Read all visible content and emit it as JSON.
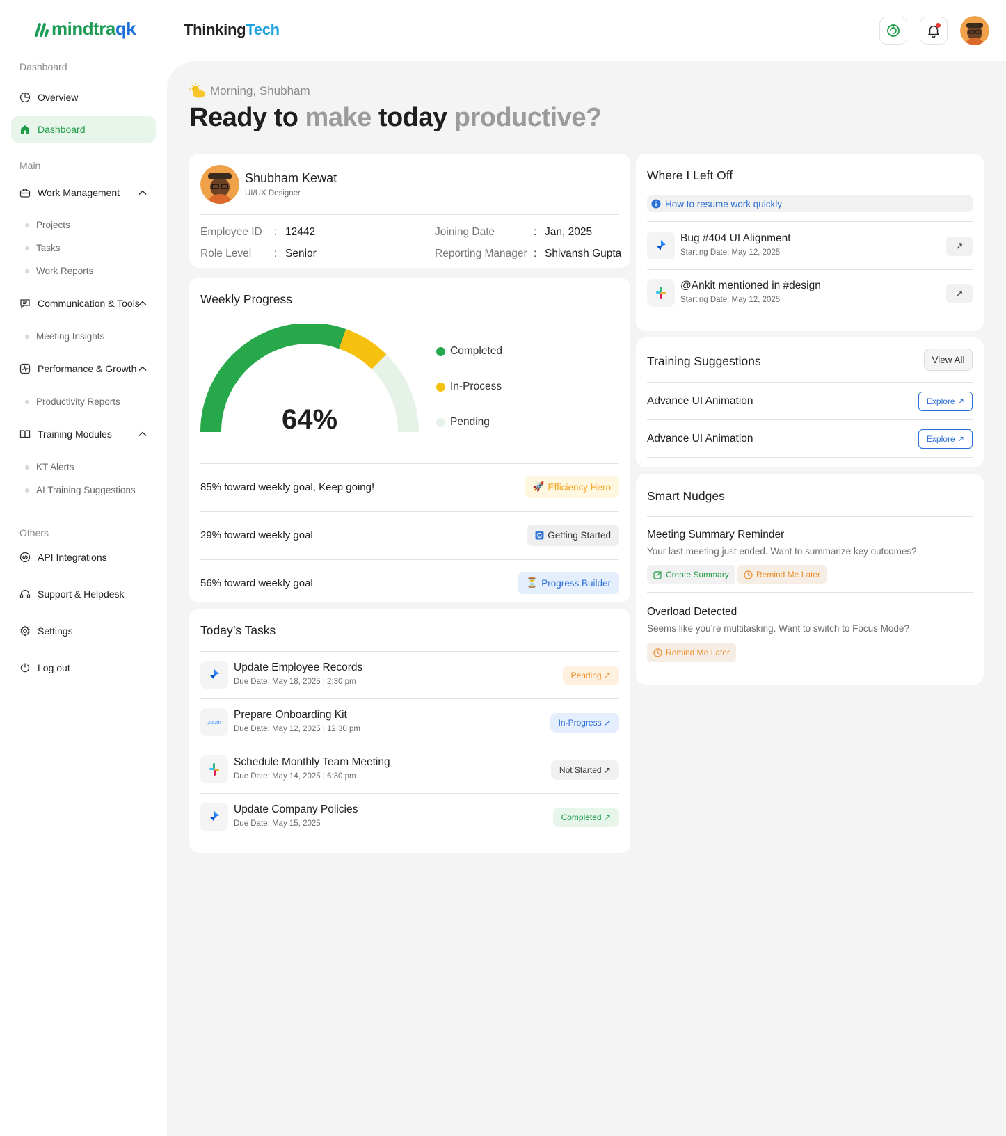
{
  "brand": {
    "logo_text_a": "mindtra",
    "logo_text_b": "qk",
    "org_a": "Thinking",
    "org_b": "Tech"
  },
  "colors": {
    "brand_green": "#1e9c45",
    "brand_blue": "#2a6fd6",
    "accent_yellow": "#f5c10e",
    "pending": "#e6f2e8"
  },
  "sidebar": {
    "section_dashboard": "Dashboard",
    "overview": "Overview",
    "dashboard": "Dashboard",
    "section_main": "Main",
    "work_management": "Work Management",
    "projects": "Projects",
    "tasks": "Tasks",
    "work_reports": "Work Reports",
    "communication": "Communication & Tools",
    "meeting_insights": "Meeting Insights",
    "performance": "Performance & Growth",
    "productivity_reports": "Productivity Reports",
    "training_modules": "Training Modules",
    "kt_alerts": "KT Alerts",
    "ai_training": "AI Training Suggestions",
    "section_others": "Others",
    "api": "API Integrations",
    "support": "Support & Helpdesk",
    "settings": "Settings",
    "logout": "Log out"
  },
  "greeting": {
    "hello": "Morning, Shubham",
    "h1": "Ready to",
    "h2": "make",
    "h3": "today",
    "h4": "productive?"
  },
  "profile": {
    "name": "Shubham Kewat",
    "role": "UI/UX Designer",
    "emp_id_label": "Employee ID",
    "emp_id": "12442",
    "role_level_label": "Role Level",
    "role_level": "Senior",
    "joining_label": "Joining Date",
    "joining": "Jan, 2025",
    "manager_label": "Reporting Manager",
    "manager": "Shivansh Gupta",
    "colon": ":"
  },
  "weekly": {
    "title": "Weekly Progress",
    "percent": "64%",
    "percent_value": 64,
    "legend_completed": "Completed",
    "legend_inprocess": "In-Process",
    "legend_pending": "Pending",
    "goals": [
      {
        "text": "85% toward weekly goal, Keep going!",
        "badge": "Efficiency Hero"
      },
      {
        "text": "29% toward weekly goal",
        "badge": "Getting Started"
      },
      {
        "text": "56% toward weekly goal",
        "badge": "Progress Builder"
      }
    ]
  },
  "tasks": {
    "title": "Today’s Tasks",
    "items": [
      {
        "title": "Update Employee Records",
        "due": "Due Date: May 18, 2025 | 2:30 pm",
        "status": "Pending ↗"
      },
      {
        "title": "Prepare Onboarding Kit",
        "due": "Due Date: May 12, 2025 | 12:30 pm",
        "status": "In-Progress ↗"
      },
      {
        "title": "Schedule Monthly Team Meeting",
        "due": "Due Date: May 14, 2025 | 6:30 pm",
        "status": "Not Started ↗"
      },
      {
        "title": "Update Company Policies",
        "due": "Due Date: May 15, 2025",
        "status": "Completed ↗"
      }
    ],
    "zoom_label": "zoom"
  },
  "left_off": {
    "title": "Where I Left Off",
    "info": "How to resume work quickly",
    "items": [
      {
        "title": "Bug #404 UI Alignment",
        "date": "Starting Date: May 12, 2025"
      },
      {
        "title": "@Ankit mentioned in #design",
        "date": "Starting Date: May 12, 2025"
      }
    ]
  },
  "training": {
    "title": "Training Suggestions",
    "view_all": "View All",
    "items": [
      {
        "title": "Advance UI Animation",
        "action": "Explore ↗"
      },
      {
        "title": "Advance UI Animation",
        "action": "Explore ↗"
      }
    ]
  },
  "nudges": {
    "title": "Smart Nudges",
    "n1_title": "Meeting Summary Reminder",
    "n1_desc": "Your last meeting just ended. Want to summarize key outcomes?",
    "n1_btn_a": "Create Summary",
    "n1_btn_b": "Remind Me Later",
    "n2_title": "Overload Detected",
    "n2_desc": "Seems like you’re multitasking. Want to switch to Focus Mode?",
    "n2_btn": "Remind Me Later"
  }
}
